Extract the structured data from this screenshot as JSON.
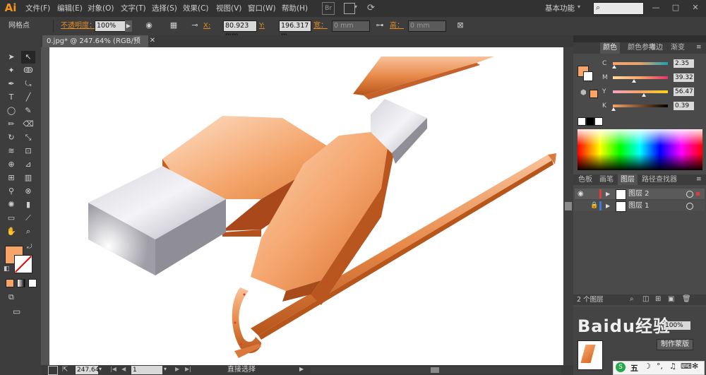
{
  "app": {
    "logo": "Ai"
  },
  "menu": [
    "文件(F)",
    "编辑(E)",
    "对象(O)",
    "文字(T)",
    "选择(S)",
    "效果(C)",
    "视图(V)",
    "窗口(W)",
    "帮助(H)"
  ],
  "menu_extra": {
    "br_badge": "Br",
    "workspace": "基本功能"
  },
  "control": {
    "selection_label": "网格点",
    "opacity_label": "不透明度：",
    "opacity_value": "100%",
    "x_label": "X:",
    "x_value": "80.923 mm",
    "y_label": "Y:",
    "y_value": "196.317 m",
    "width_label": "宽：",
    "width_value": "0 mm",
    "height_label": "高：",
    "height_value": "0 mm"
  },
  "document": {
    "tab_title": "0.jpg* @ 247.64% (RGB/预览)"
  },
  "status": {
    "zoom": "247.64",
    "page": "1",
    "tool_text": "直接选择"
  },
  "color_panel": {
    "tabs": [
      "颜色",
      "颜色参考",
      "描边",
      "渐变"
    ],
    "fill_color": "#f7a469",
    "sliders": [
      {
        "label": "C",
        "value": "2.35",
        "pos": 0.02,
        "gradient": "linear-gradient(to right,#f7a469,#e6a36d,#1aa3b4)"
      },
      {
        "label": "M",
        "value": "39.32",
        "pos": 0.39,
        "gradient": "linear-gradient(to right,#ffd8a0,#f7a469,#e8326b)"
      },
      {
        "label": "Y",
        "value": "56.47",
        "pos": 0.56,
        "gradient": "linear-gradient(to right,#f3a3c4,#f7a469,#f7d31a)"
      },
      {
        "label": "K",
        "value": "0.39",
        "pos": 0.01,
        "gradient": "linear-gradient(to right,#f7a469,#7a5032,#000)"
      }
    ]
  },
  "layers_panel": {
    "tabs": [
      "色板",
      "画笔",
      "图层",
      "路径查找器"
    ],
    "layers": [
      {
        "name": "图层 2",
        "color": "#e03c3c",
        "visible": true,
        "locked": false
      },
      {
        "name": "图层 1",
        "color": "#3c7ae0",
        "visible": false,
        "locked": true
      }
    ],
    "count": "2 个图层"
  },
  "bottom_panel": {
    "watermark": "Baidu经验",
    "zoom_value": "100%",
    "button": "制作蒙版"
  },
  "taskbar": {
    "ime": "五"
  }
}
